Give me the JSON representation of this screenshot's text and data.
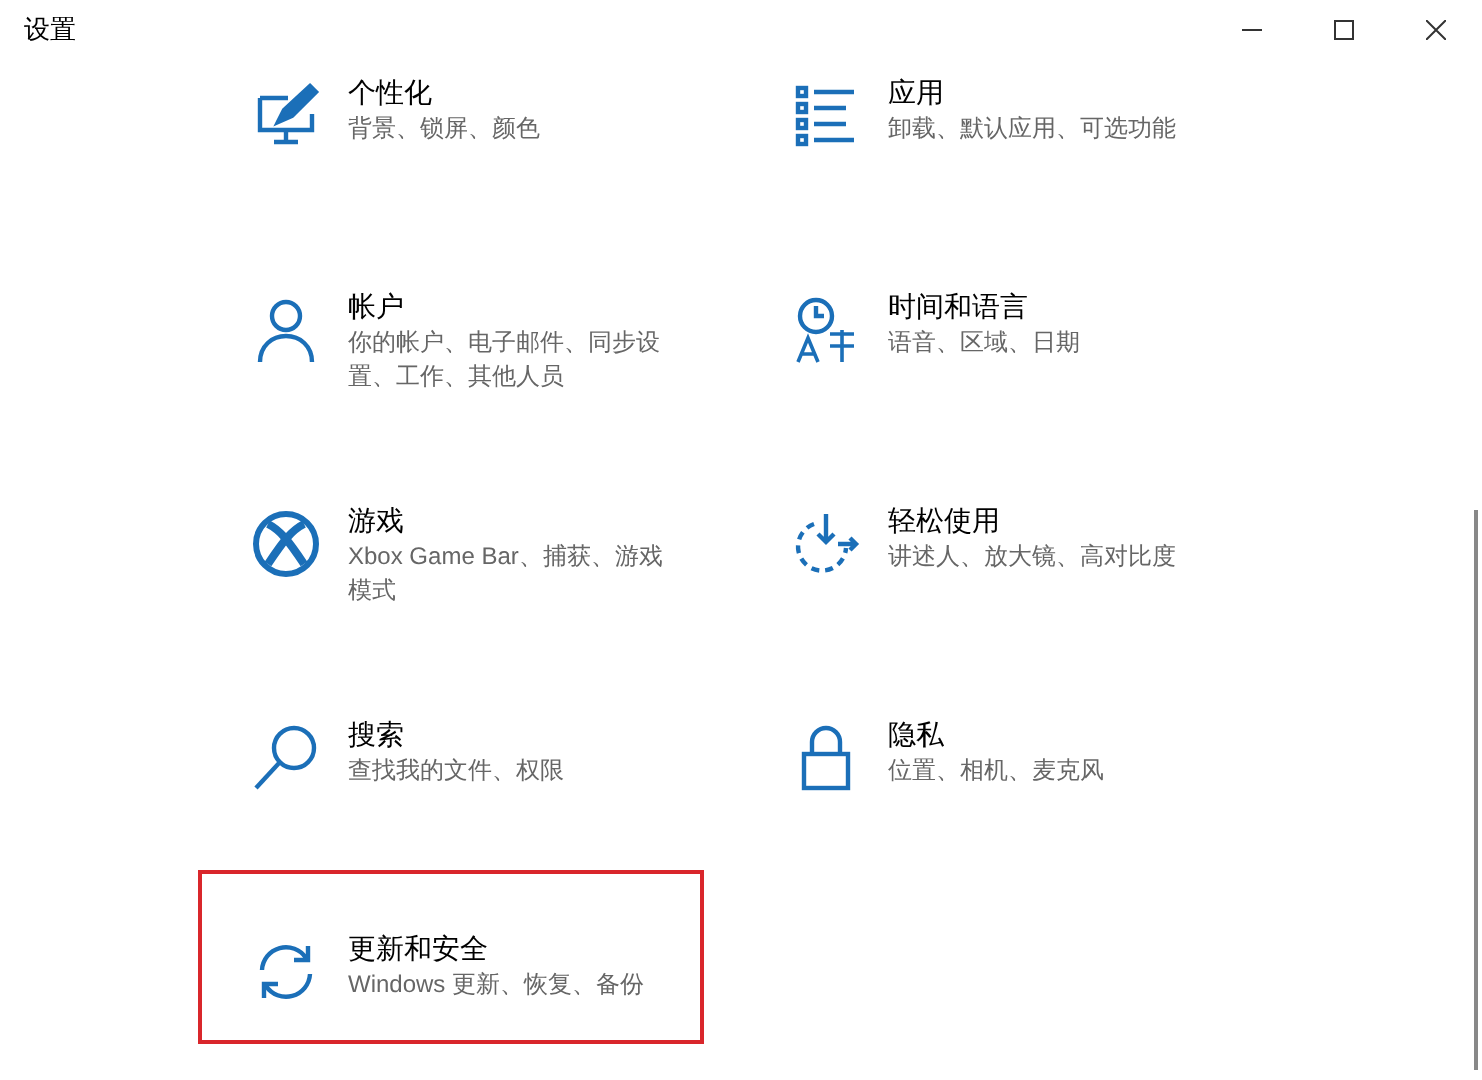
{
  "window": {
    "title": "设置"
  },
  "categories": [
    {
      "title": "个性化",
      "subtitle": "背景、锁屏、颜色",
      "highlighted": false
    },
    {
      "title": "应用",
      "subtitle": "卸载、默认应用、可选功能",
      "highlighted": false
    },
    {
      "title": "帐户",
      "subtitle": "你的帐户、电子邮件、同步设置、工作、其他人员",
      "highlighted": false
    },
    {
      "title": "时间和语言",
      "subtitle": "语音、区域、日期",
      "highlighted": false
    },
    {
      "title": "游戏",
      "subtitle": "Xbox Game Bar、捕获、游戏模式",
      "highlighted": false
    },
    {
      "title": "轻松使用",
      "subtitle": "讲述人、放大镜、高对比度",
      "highlighted": false
    },
    {
      "title": "搜索",
      "subtitle": "查找我的文件、权限",
      "highlighted": false
    },
    {
      "title": "隐私",
      "subtitle": "位置、相机、麦克风",
      "highlighted": false
    },
    {
      "title": "更新和安全",
      "subtitle": "Windows 更新、恢复、备份",
      "highlighted": true
    }
  ]
}
